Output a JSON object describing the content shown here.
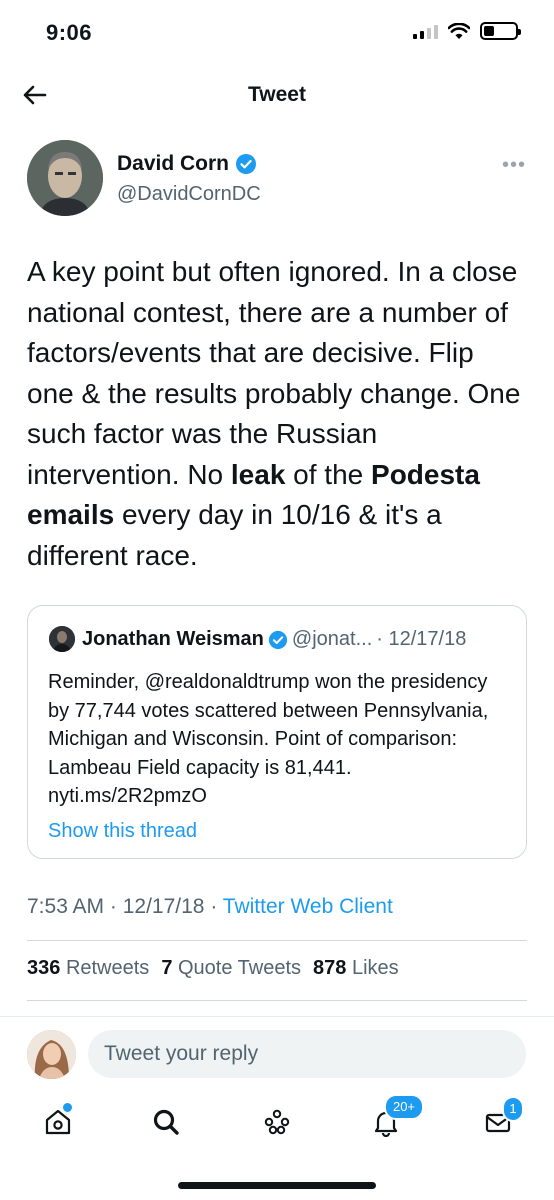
{
  "status_bar": {
    "time": "9:06"
  },
  "header": {
    "title": "Tweet"
  },
  "author": {
    "name": "David Corn",
    "handle": "@DavidCornDC",
    "verified": true
  },
  "tweet": {
    "segments": [
      "A key point but often ignored. In a close national contest, there are a number of factors/events that are decisive. Flip one & the results probably change. One such factor was the Russian intervention. No ",
      "leak",
      " of the ",
      "Podesta emails",
      " every day in 10/16 & it's a different race."
    ]
  },
  "quote": {
    "name": "Jonathan Weisman",
    "handle": "@jonat...",
    "date": "· 12/17/18",
    "text": "Reminder, @realdonaldtrump won the presidency by 77,744 votes scattered between Pennsylvania, Michigan and Wisconsin. Point of comparison: Lambeau Field capacity is 81,441. nyti.ms/2R2pmzO",
    "show_thread": "Show this thread"
  },
  "meta": {
    "time": "7:53 AM",
    "date": "12/17/18",
    "source": "Twitter Web Client"
  },
  "stats": {
    "retweets_count": "336",
    "retweets_label": "Retweets",
    "quotes_count": "7",
    "quotes_label": "Quote Tweets",
    "likes_count": "878",
    "likes_label": "Likes"
  },
  "reply": {
    "placeholder": "Tweet your reply"
  },
  "tabbar": {
    "notifications_badge": "20+",
    "messages_badge": "1"
  },
  "colors": {
    "accent": "#1d9bf0",
    "secondary_text": "#536471",
    "border": "#cfd9de"
  }
}
